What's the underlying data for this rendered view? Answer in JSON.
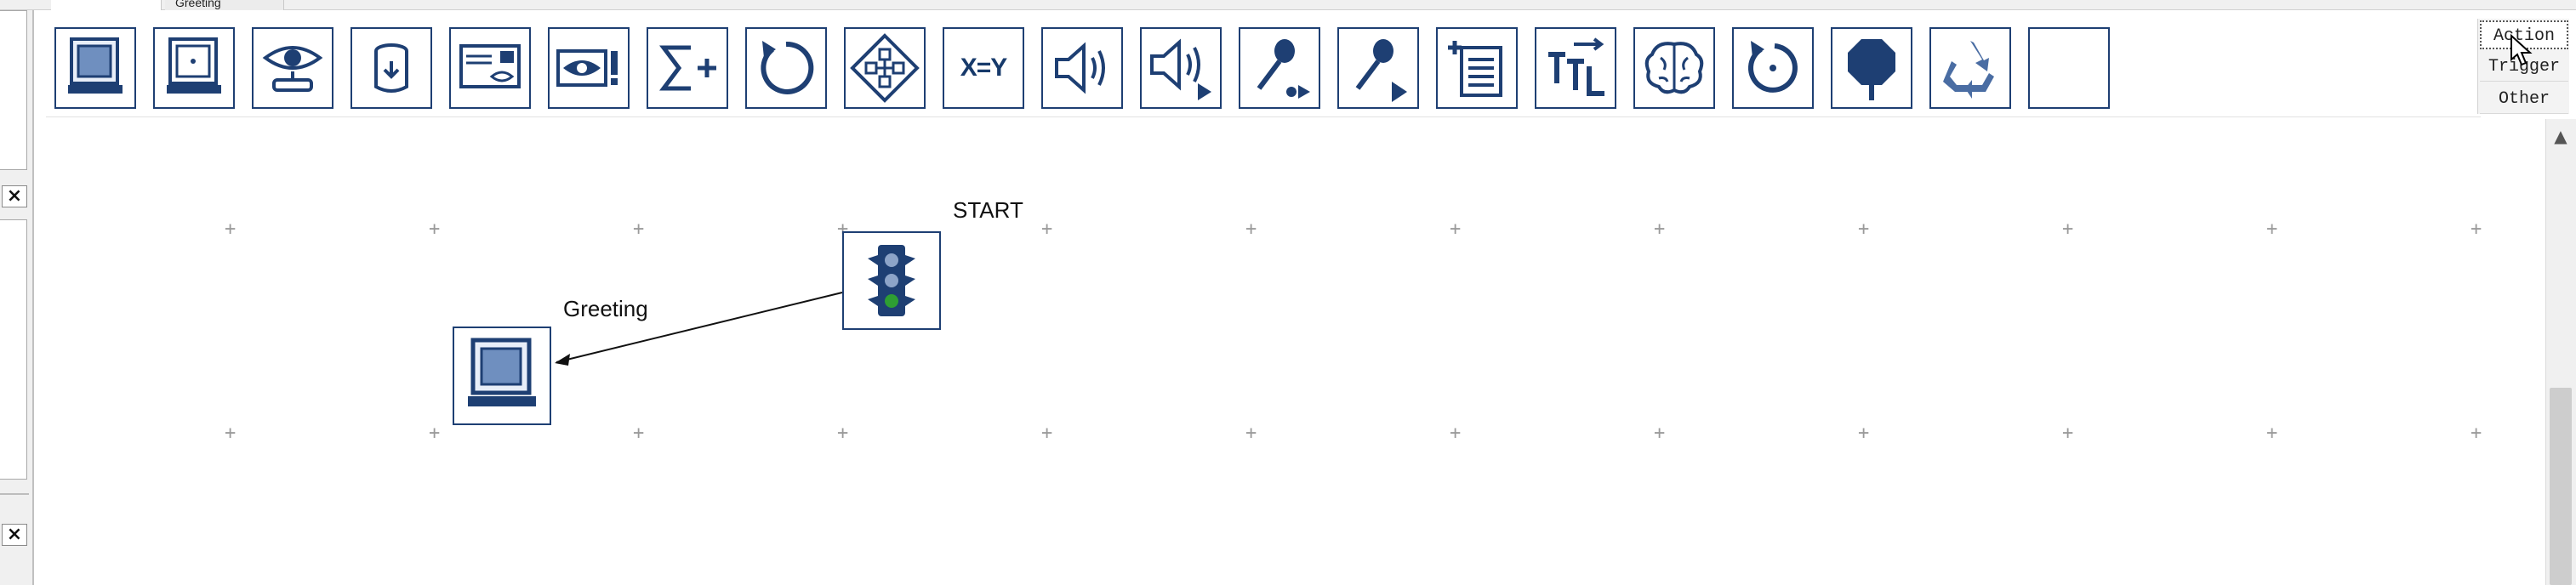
{
  "tabs": {
    "active": "",
    "second": "Greeting"
  },
  "toolbar": {
    "tools": [
      {
        "icon": "monitor-icon"
      },
      {
        "icon": "monitor-dot-icon"
      },
      {
        "icon": "eye-icon"
      },
      {
        "icon": "database-icon"
      },
      {
        "icon": "envelope-icon"
      },
      {
        "icon": "alert-icon"
      },
      {
        "icon": "sigma-plus-icon"
      },
      {
        "icon": "loop-icon"
      },
      {
        "icon": "diamond-network-icon"
      },
      {
        "icon": "assign-icon",
        "text": "X=Y"
      },
      {
        "icon": "speaker-icon"
      },
      {
        "icon": "speaker-play-icon"
      },
      {
        "icon": "microphone-record-icon"
      },
      {
        "icon": "microphone-play-icon"
      },
      {
        "icon": "add-list-icon"
      },
      {
        "icon": "ttl-icon"
      },
      {
        "icon": "brain-icon"
      },
      {
        "icon": "reset-icon"
      },
      {
        "icon": "stop-sign-icon"
      },
      {
        "icon": "recycle-icon"
      },
      {
        "icon": "empty-slot-icon"
      }
    ]
  },
  "categories": [
    "Action",
    "Trigger",
    "Other"
  ],
  "canvas": {
    "start_label": "START",
    "greeting_label": "Greeting"
  },
  "colors": {
    "icon_blue": "#1e3f73",
    "grid": "#9a9a9a",
    "green_light": "#2e9e33"
  }
}
